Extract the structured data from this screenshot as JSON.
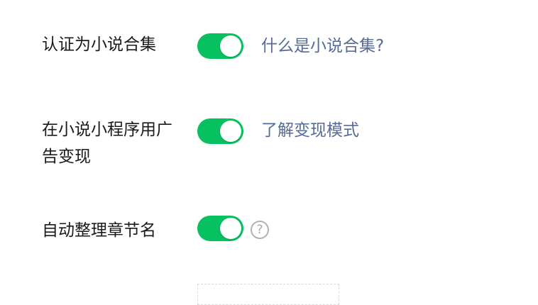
{
  "settings": [
    {
      "label": "认证为小说合集",
      "enabled": true,
      "link": "什么是小说合集?"
    },
    {
      "label": "在小说小程序用广告变现",
      "enabled": true,
      "link": "了解变现模式"
    },
    {
      "label": "自动整理章节名",
      "enabled": true,
      "help_glyph": "?"
    }
  ],
  "colors": {
    "toggle_on": "#07c160",
    "link": "#576b95",
    "label": "#1a1a1a",
    "help_icon": "#b2b2b2"
  },
  "icons": {
    "help": "question-circle-icon"
  }
}
